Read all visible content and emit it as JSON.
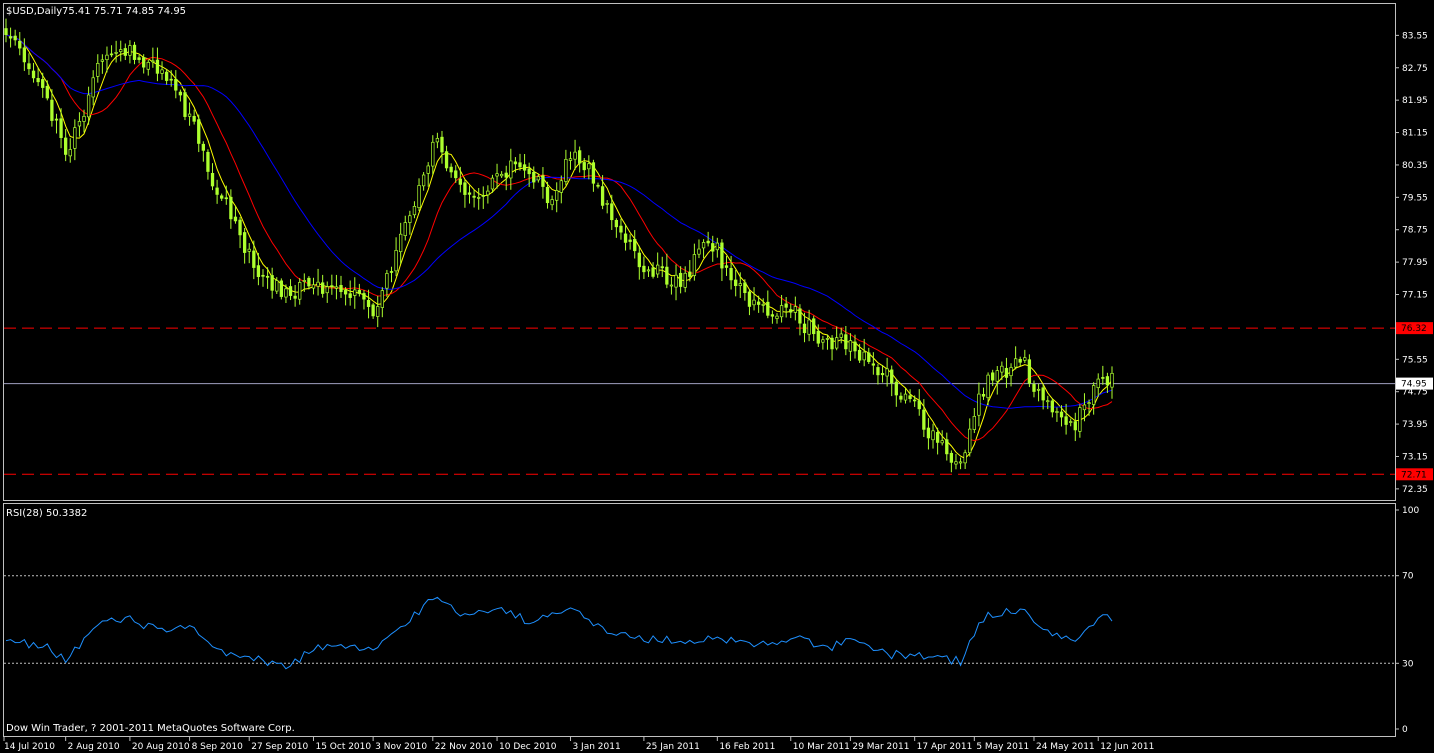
{
  "window": {
    "symbol_title": "$USD,Daily",
    "ohlc_readout": "75.41 75.71 74.85 74.95",
    "copyright": "Dow Win Trader, ? 2001-2011 MetaQuotes Software Corp."
  },
  "colors": {
    "background": "#000000",
    "frame": "#c0c0c0",
    "candle": "#adff2f",
    "ma_fast": "#ffff00",
    "ma_mid": "#ff0000",
    "ma_slow": "#0000ff",
    "rsi_line": "#1e90ff",
    "resistance": "#ff0000",
    "price_line": "#a0a0c0",
    "level_tag": "#ff0000",
    "current_tag_bg": "#ffffff",
    "current_tag_text": "#000000"
  },
  "chart_data": [
    {
      "type": "candlestick",
      "title": "$USD,Daily",
      "ylim": [
        72.1,
        84.3
      ],
      "y_ticks": [
        "83.55",
        "82.75",
        "81.95",
        "81.15",
        "80.35",
        "79.55",
        "78.75",
        "77.95",
        "77.15",
        "76.35",
        "75.55",
        "74.75",
        "73.95",
        "73.15",
        "72.35"
      ],
      "x_tick_labels": [
        "14 Jul 2010",
        "2 Aug 2010",
        "20 Aug 2010",
        "8 Sep 2010",
        "27 Sep 2010",
        "15 Oct 2010",
        "3 Nov 2010",
        "22 Nov 2010",
        "10 Dec 2010",
        "3 Jan 2011",
        "25 Jan 2011",
        "16 Feb 2011",
        "10 Mar 2011",
        "29 Mar 2011",
        "17 Apr 2011",
        "5 May 2011",
        "24 May 2011",
        "12 Jun 2011"
      ],
      "anchors": [
        [
          "14 Jul 2010",
          83.7
        ],
        [
          "20 Jul 2010",
          82.8
        ],
        [
          "27 Jul 2010",
          81.9
        ],
        [
          "2 Aug 2010",
          80.6
        ],
        [
          "6 Aug 2010",
          81.5
        ],
        [
          "11 Aug 2010",
          82.8
        ],
        [
          "17 Aug 2010",
          83.1
        ],
        [
          "20 Aug 2010",
          83.2
        ],
        [
          "26 Aug 2010",
          82.9
        ],
        [
          "1 Sep 2010",
          82.4
        ],
        [
          "8 Sep 2010",
          81.6
        ],
        [
          "14 Sep 2010",
          80.2
        ],
        [
          "21 Sep 2010",
          79.1
        ],
        [
          "27 Sep 2010",
          78.1
        ],
        [
          "4 Oct 2010",
          77.3
        ],
        [
          "8 Oct 2010",
          77.2
        ],
        [
          "15 Oct 2010",
          77.4
        ],
        [
          "20 Oct 2010",
          77.2
        ],
        [
          "26 Oct 2010",
          77.3
        ],
        [
          "3 Nov 2010",
          76.6
        ],
        [
          "9 Nov 2010",
          77.8
        ],
        [
          "15 Nov 2010",
          79.1
        ],
        [
          "19 Nov 2010",
          80.3
        ],
        [
          "22 Nov 2010",
          81.0
        ],
        [
          "26 Nov 2010",
          80.3
        ],
        [
          "1 Dec 2010",
          79.7
        ],
        [
          "6 Dec 2010",
          79.6
        ],
        [
          "10 Dec 2010",
          80.2
        ],
        [
          "16 Dec 2010",
          80.3
        ],
        [
          "22 Dec 2010",
          80.0
        ],
        [
          "28 Dec 2010",
          79.5
        ],
        [
          "3 Jan 2011",
          80.6
        ],
        [
          "7 Jan 2011",
          80.2
        ],
        [
          "12 Jan 2011",
          79.4
        ],
        [
          "18 Jan 2011",
          78.6
        ],
        [
          "25 Jan 2011",
          77.9
        ],
        [
          "31 Jan 2011",
          77.6
        ],
        [
          "5 Feb 2011",
          77.5
        ],
        [
          "11 Feb 2011",
          78.4
        ],
        [
          "16 Feb 2011",
          78.2
        ],
        [
          "22 Feb 2011",
          77.4
        ],
        [
          "28 Feb 2011",
          76.9
        ],
        [
          "4 Mar 2011",
          76.6
        ],
        [
          "10 Mar 2011",
          76.8
        ],
        [
          "16 Mar 2011",
          76.3
        ],
        [
          "22 Mar 2011",
          75.9
        ],
        [
          "29 Mar 2011",
          76.0
        ],
        [
          "4 Apr 2011",
          75.5
        ],
        [
          "10 Apr 2011",
          75.0
        ],
        [
          "17 Apr 2011",
          74.4
        ],
        [
          "24 Apr 2011",
          73.4
        ],
        [
          "30 Apr 2011",
          73.0
        ],
        [
          "5 May 2011",
          74.2
        ],
        [
          "10 May 2011",
          75.1
        ],
        [
          "16 May 2011",
          75.3
        ],
        [
          "20 May 2011",
          75.4
        ],
        [
          "24 May 2011",
          74.8
        ],
        [
          "30 May 2011",
          74.2
        ],
        [
          "5 Jun 2011",
          73.9
        ],
        [
          "9 Jun 2011",
          74.6
        ],
        [
          "14 Jun 2011",
          75.1
        ],
        [
          "16 Jun 2011",
          75.0
        ]
      ],
      "horizontal_levels": [
        {
          "value": 76.32,
          "label": "76.32"
        },
        {
          "value": 72.71,
          "label": "72.71"
        }
      ],
      "current_price": {
        "value": 74.95,
        "label": "74.95"
      }
    },
    {
      "type": "line",
      "title": "RSI(28) 50.3382",
      "ylim": [
        0,
        100
      ],
      "y_ticks": [
        "100",
        "70",
        "30",
        "0"
      ],
      "levels": [
        70,
        30
      ],
      "anchors": [
        [
          "14 Jul 2010",
          40
        ],
        [
          "27 Jul 2010",
          38
        ],
        [
          "2 Aug 2010",
          31
        ],
        [
          "11 Aug 2010",
          48
        ],
        [
          "20 Aug 2010",
          50
        ],
        [
          "1 Sep 2010",
          44
        ],
        [
          "8 Sep 2010",
          47
        ],
        [
          "14 Sep 2010",
          38
        ],
        [
          "21 Sep 2010",
          34
        ],
        [
          "27 Sep 2010",
          32
        ],
        [
          "8 Oct 2010",
          29
        ],
        [
          "15 Oct 2010",
          37
        ],
        [
          "26 Oct 2010",
          37
        ],
        [
          "3 Nov 2010",
          36
        ],
        [
          "15 Nov 2010",
          50
        ],
        [
          "22 Nov 2010",
          60
        ],
        [
          "1 Dec 2010",
          52
        ],
        [
          "10 Dec 2010",
          56
        ],
        [
          "22 Dec 2010",
          48
        ],
        [
          "3 Jan 2011",
          57
        ],
        [
          "12 Jan 2011",
          45
        ],
        [
          "25 Jan 2011",
          41
        ],
        [
          "5 Feb 2011",
          40
        ],
        [
          "16 Feb 2011",
          42
        ],
        [
          "28 Feb 2011",
          38
        ],
        [
          "10 Mar 2011",
          42
        ],
        [
          "22 Mar 2011",
          37
        ],
        [
          "29 Mar 2011",
          40
        ],
        [
          "10 Apr 2011",
          34
        ],
        [
          "17 Apr 2011",
          34
        ],
        [
          "30 Apr 2011",
          31
        ],
        [
          "5 May 2011",
          44
        ],
        [
          "10 May 2011",
          52
        ],
        [
          "20 May 2011",
          55
        ],
        [
          "24 May 2011",
          47
        ],
        [
          "5 Jun 2011",
          40
        ],
        [
          "9 Jun 2011",
          45
        ],
        [
          "14 Jun 2011",
          52
        ],
        [
          "16 Jun 2011",
          50
        ]
      ]
    }
  ]
}
